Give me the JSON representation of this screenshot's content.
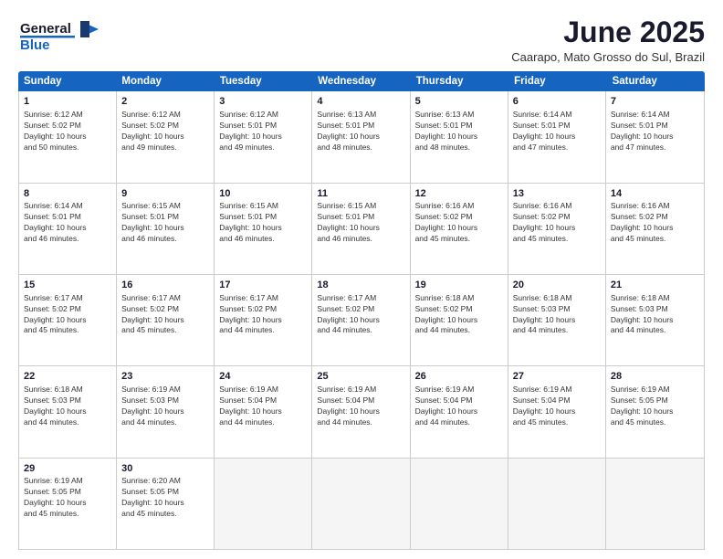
{
  "logo": {
    "line1": "General",
    "line2": "Blue"
  },
  "title": "June 2025",
  "subtitle": "Caarapo, Mato Grosso do Sul, Brazil",
  "weekdays": [
    "Sunday",
    "Monday",
    "Tuesday",
    "Wednesday",
    "Thursday",
    "Friday",
    "Saturday"
  ],
  "rows": [
    [
      {
        "day": "1",
        "lines": [
          "Sunrise: 6:12 AM",
          "Sunset: 5:02 PM",
          "Daylight: 10 hours",
          "and 50 minutes."
        ]
      },
      {
        "day": "2",
        "lines": [
          "Sunrise: 6:12 AM",
          "Sunset: 5:02 PM",
          "Daylight: 10 hours",
          "and 49 minutes."
        ]
      },
      {
        "day": "3",
        "lines": [
          "Sunrise: 6:12 AM",
          "Sunset: 5:01 PM",
          "Daylight: 10 hours",
          "and 49 minutes."
        ]
      },
      {
        "day": "4",
        "lines": [
          "Sunrise: 6:13 AM",
          "Sunset: 5:01 PM",
          "Daylight: 10 hours",
          "and 48 minutes."
        ]
      },
      {
        "day": "5",
        "lines": [
          "Sunrise: 6:13 AM",
          "Sunset: 5:01 PM",
          "Daylight: 10 hours",
          "and 48 minutes."
        ]
      },
      {
        "day": "6",
        "lines": [
          "Sunrise: 6:14 AM",
          "Sunset: 5:01 PM",
          "Daylight: 10 hours",
          "and 47 minutes."
        ]
      },
      {
        "day": "7",
        "lines": [
          "Sunrise: 6:14 AM",
          "Sunset: 5:01 PM",
          "Daylight: 10 hours",
          "and 47 minutes."
        ]
      }
    ],
    [
      {
        "day": "8",
        "lines": [
          "Sunrise: 6:14 AM",
          "Sunset: 5:01 PM",
          "Daylight: 10 hours",
          "and 46 minutes."
        ]
      },
      {
        "day": "9",
        "lines": [
          "Sunrise: 6:15 AM",
          "Sunset: 5:01 PM",
          "Daylight: 10 hours",
          "and 46 minutes."
        ]
      },
      {
        "day": "10",
        "lines": [
          "Sunrise: 6:15 AM",
          "Sunset: 5:01 PM",
          "Daylight: 10 hours",
          "and 46 minutes."
        ]
      },
      {
        "day": "11",
        "lines": [
          "Sunrise: 6:15 AM",
          "Sunset: 5:01 PM",
          "Daylight: 10 hours",
          "and 46 minutes."
        ]
      },
      {
        "day": "12",
        "lines": [
          "Sunrise: 6:16 AM",
          "Sunset: 5:02 PM",
          "Daylight: 10 hours",
          "and 45 minutes."
        ]
      },
      {
        "day": "13",
        "lines": [
          "Sunrise: 6:16 AM",
          "Sunset: 5:02 PM",
          "Daylight: 10 hours",
          "and 45 minutes."
        ]
      },
      {
        "day": "14",
        "lines": [
          "Sunrise: 6:16 AM",
          "Sunset: 5:02 PM",
          "Daylight: 10 hours",
          "and 45 minutes."
        ]
      }
    ],
    [
      {
        "day": "15",
        "lines": [
          "Sunrise: 6:17 AM",
          "Sunset: 5:02 PM",
          "Daylight: 10 hours",
          "and 45 minutes."
        ]
      },
      {
        "day": "16",
        "lines": [
          "Sunrise: 6:17 AM",
          "Sunset: 5:02 PM",
          "Daylight: 10 hours",
          "and 45 minutes."
        ]
      },
      {
        "day": "17",
        "lines": [
          "Sunrise: 6:17 AM",
          "Sunset: 5:02 PM",
          "Daylight: 10 hours",
          "and 44 minutes."
        ]
      },
      {
        "day": "18",
        "lines": [
          "Sunrise: 6:17 AM",
          "Sunset: 5:02 PM",
          "Daylight: 10 hours",
          "and 44 minutes."
        ]
      },
      {
        "day": "19",
        "lines": [
          "Sunrise: 6:18 AM",
          "Sunset: 5:02 PM",
          "Daylight: 10 hours",
          "and 44 minutes."
        ]
      },
      {
        "day": "20",
        "lines": [
          "Sunrise: 6:18 AM",
          "Sunset: 5:03 PM",
          "Daylight: 10 hours",
          "and 44 minutes."
        ]
      },
      {
        "day": "21",
        "lines": [
          "Sunrise: 6:18 AM",
          "Sunset: 5:03 PM",
          "Daylight: 10 hours",
          "and 44 minutes."
        ]
      }
    ],
    [
      {
        "day": "22",
        "lines": [
          "Sunrise: 6:18 AM",
          "Sunset: 5:03 PM",
          "Daylight: 10 hours",
          "and 44 minutes."
        ]
      },
      {
        "day": "23",
        "lines": [
          "Sunrise: 6:19 AM",
          "Sunset: 5:03 PM",
          "Daylight: 10 hours",
          "and 44 minutes."
        ]
      },
      {
        "day": "24",
        "lines": [
          "Sunrise: 6:19 AM",
          "Sunset: 5:04 PM",
          "Daylight: 10 hours",
          "and 44 minutes."
        ]
      },
      {
        "day": "25",
        "lines": [
          "Sunrise: 6:19 AM",
          "Sunset: 5:04 PM",
          "Daylight: 10 hours",
          "and 44 minutes."
        ]
      },
      {
        "day": "26",
        "lines": [
          "Sunrise: 6:19 AM",
          "Sunset: 5:04 PM",
          "Daylight: 10 hours",
          "and 44 minutes."
        ]
      },
      {
        "day": "27",
        "lines": [
          "Sunrise: 6:19 AM",
          "Sunset: 5:04 PM",
          "Daylight: 10 hours",
          "and 45 minutes."
        ]
      },
      {
        "day": "28",
        "lines": [
          "Sunrise: 6:19 AM",
          "Sunset: 5:05 PM",
          "Daylight: 10 hours",
          "and 45 minutes."
        ]
      }
    ],
    [
      {
        "day": "29",
        "lines": [
          "Sunrise: 6:19 AM",
          "Sunset: 5:05 PM",
          "Daylight: 10 hours",
          "and 45 minutes."
        ]
      },
      {
        "day": "30",
        "lines": [
          "Sunrise: 6:20 AM",
          "Sunset: 5:05 PM",
          "Daylight: 10 hours",
          "and 45 minutes."
        ]
      },
      {
        "day": "",
        "lines": [],
        "empty": true
      },
      {
        "day": "",
        "lines": [],
        "empty": true
      },
      {
        "day": "",
        "lines": [],
        "empty": true
      },
      {
        "day": "",
        "lines": [],
        "empty": true
      },
      {
        "day": "",
        "lines": [],
        "empty": true
      }
    ]
  ]
}
